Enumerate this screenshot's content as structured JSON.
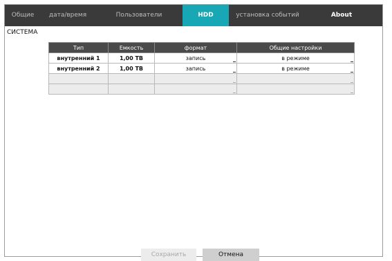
{
  "tabs": [
    {
      "label": "Общие"
    },
    {
      "label": "дата/время"
    },
    {
      "label": "Пользователи"
    },
    {
      "label": "HDD"
    },
    {
      "label": "установка событий"
    },
    {
      "label": "About"
    }
  ],
  "section_title": "СИСТЕМА",
  "table": {
    "headers": [
      "Тип",
      "Емкость",
      "формат",
      "Общие настройки"
    ],
    "rows": [
      {
        "type": "внутренний 1",
        "capacity": "1,00 TB",
        "format": "запись",
        "mode": "в режиме"
      },
      {
        "type": "внутренний 2",
        "capacity": "1,00 TB",
        "format": "запись",
        "mode": "в режиме"
      }
    ]
  },
  "buttons": {
    "save": "Сохранить",
    "cancel": "Отмена"
  },
  "colors": {
    "tab_bar": "#3a3a3a",
    "active_tab": "#18a7b5",
    "header": "#4a4a4a"
  }
}
